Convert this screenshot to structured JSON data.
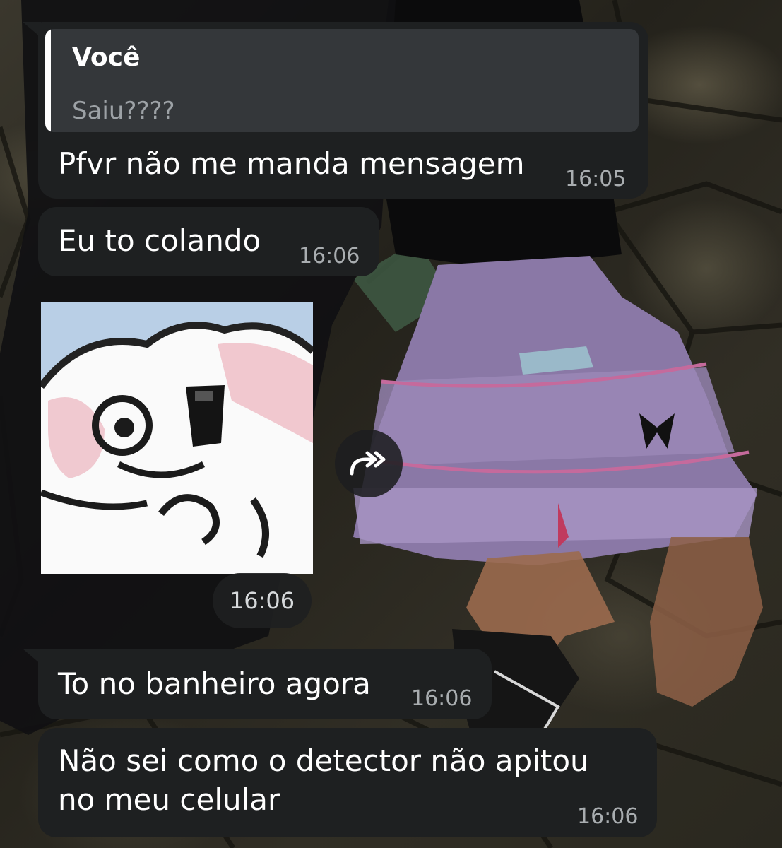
{
  "messages": [
    {
      "reply_to": {
        "author": "Você",
        "text": "Saiu????"
      },
      "text": "Pfvr não me manda mensagem",
      "time": "16:05"
    },
    {
      "text": "Eu to colando",
      "time": "16:06"
    },
    {
      "sticker": "dog-meme-sticker",
      "time": "16:06"
    },
    {
      "text": "To no banheiro agora",
      "time": "16:06"
    },
    {
      "lines": [
        "Não sei como o detector não apitou",
        "no meu celular"
      ],
      "time": "16:06"
    }
  ],
  "icons": {
    "forward": "forward-share-icon"
  },
  "colors": {
    "bubble": "#1e2021",
    "quote_background": "#34373a",
    "timestamp": "#a9adb0",
    "quote_text": "#9da2a6"
  }
}
